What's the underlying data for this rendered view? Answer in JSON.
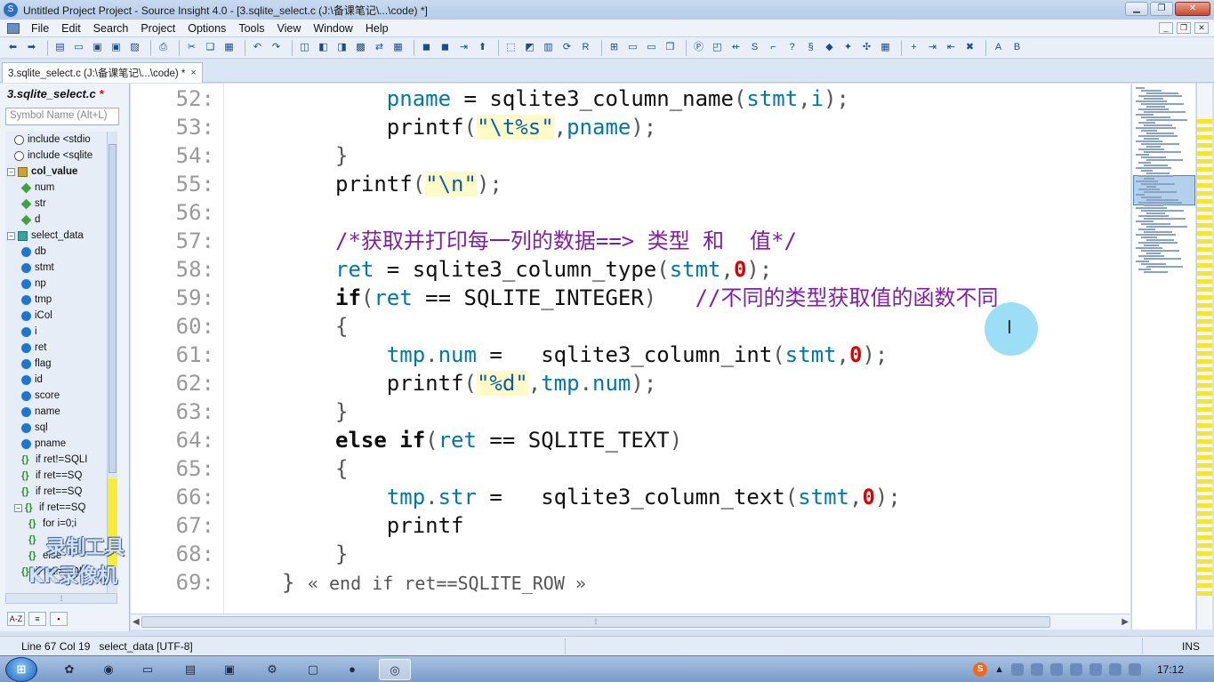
{
  "window": {
    "title": "Untitled Project Project - Source Insight 4.0 - [3.sqlite_select.c (J:\\备课笔记\\...\\code) *]"
  },
  "menu": [
    "File",
    "Edit",
    "Search",
    "Project",
    "Options",
    "Tools",
    "View",
    "Window",
    "Help"
  ],
  "tab": {
    "label": "3.sqlite_select.c (J:\\备课笔记\\...\\code) *",
    "close": "×"
  },
  "symbol_panel": {
    "title": "3.sqlite_select.c",
    "modified_mark": "*",
    "search_placeholder": "Symbol Name (Alt+L)",
    "items": [
      {
        "indent": 1,
        "icon": "hash",
        "label": "include <stdio",
        "twisty": ""
      },
      {
        "indent": 1,
        "icon": "hash",
        "label": "include <sqlite",
        "twisty": ""
      },
      {
        "indent": 0,
        "icon": "struct",
        "label": "col_value",
        "twisty": "−",
        "bold": true
      },
      {
        "indent": 2,
        "icon": "field",
        "label": "num",
        "twisty": ""
      },
      {
        "indent": 2,
        "icon": "field",
        "label": "str",
        "twisty": ""
      },
      {
        "indent": 2,
        "icon": "field",
        "label": "d",
        "twisty": ""
      },
      {
        "indent": 0,
        "icon": "func",
        "label": "select_data",
        "twisty": "−"
      },
      {
        "indent": 2,
        "icon": "var",
        "label": "db",
        "twisty": ""
      },
      {
        "indent": 2,
        "icon": "var",
        "label": "stmt",
        "twisty": ""
      },
      {
        "indent": 2,
        "icon": "var",
        "label": "np",
        "twisty": ""
      },
      {
        "indent": 2,
        "icon": "var",
        "label": "tmp",
        "twisty": ""
      },
      {
        "indent": 2,
        "icon": "var",
        "label": "iCol",
        "twisty": ""
      },
      {
        "indent": 2,
        "icon": "var",
        "label": "i",
        "twisty": ""
      },
      {
        "indent": 2,
        "icon": "var",
        "label": "ret",
        "twisty": ""
      },
      {
        "indent": 2,
        "icon": "var",
        "label": "flag",
        "twisty": ""
      },
      {
        "indent": 2,
        "icon": "var",
        "label": "id",
        "twisty": ""
      },
      {
        "indent": 2,
        "icon": "var",
        "label": "score",
        "twisty": ""
      },
      {
        "indent": 2,
        "icon": "var",
        "label": "name",
        "twisty": ""
      },
      {
        "indent": 2,
        "icon": "var",
        "label": "sql",
        "twisty": ""
      },
      {
        "indent": 2,
        "icon": "var",
        "label": "pname",
        "twisty": ""
      },
      {
        "indent": 2,
        "icon": "brace",
        "label": "if ret!=SQLI",
        "twisty": ""
      },
      {
        "indent": 2,
        "icon": "brace",
        "label": "if ret==SQ",
        "twisty": ""
      },
      {
        "indent": 2,
        "icon": "brace",
        "label": "if ret==SQ",
        "twisty": ""
      },
      {
        "indent": 1,
        "icon": "brace",
        "label": "if ret==SQ",
        "twisty": "−"
      },
      {
        "indent": 3,
        "icon": "brace",
        "label": "for i=0;i",
        "twisty": ""
      },
      {
        "indent": 3,
        "icon": "brace",
        "label": "",
        "twisty": ""
      },
      {
        "indent": 3,
        "icon": "brace",
        "label": "else",
        "twisty": ""
      },
      {
        "indent": 2,
        "icon": "brace",
        "label": "if ret!=SQL",
        "twisty": ""
      }
    ],
    "bottom_buttons": [
      "A-Z",
      "≡",
      "▪"
    ]
  },
  "editor": {
    "lines": [
      {
        "n": "52:",
        "tokens": [
          [
            "    pname ",
            "var"
          ],
          [
            "= ",
            "id"
          ],
          [
            "sqlite3_column_name",
            "id"
          ],
          [
            "(",
            "punc"
          ],
          [
            "stmt",
            "var"
          ],
          [
            ",",
            "punc"
          ],
          [
            "i",
            "var"
          ],
          [
            ");",
            "punc"
          ]
        ]
      },
      {
        "n": "53:",
        "tokens": [
          [
            "    printf",
            "id"
          ],
          [
            "(",
            "punc"
          ],
          [
            "\"\\t%s\"",
            "str"
          ],
          [
            ",",
            "punc"
          ],
          [
            "pname",
            "var"
          ],
          [
            ");",
            "punc"
          ]
        ]
      },
      {
        "n": "54:",
        "tokens": [
          [
            "}",
            "punc"
          ]
        ]
      },
      {
        "n": "55:",
        "tokens": [
          [
            "printf",
            "id"
          ],
          [
            "(",
            "punc"
          ],
          [
            "\"\\n\"",
            "str"
          ],
          [
            ");",
            "punc"
          ]
        ]
      },
      {
        "n": "56:",
        "tokens": []
      },
      {
        "n": "57:",
        "tokens": [
          [
            "/*获取并打印每一列的数据==> 类型 和  值*/",
            "cmt"
          ]
        ]
      },
      {
        "n": "58:",
        "tokens": [
          [
            "ret ",
            "var"
          ],
          [
            "= ",
            "id"
          ],
          [
            "sqlite3_column_type",
            "id"
          ],
          [
            "(",
            "punc"
          ],
          [
            "stmt",
            "var"
          ],
          [
            ",",
            "punc"
          ],
          [
            "0",
            "num"
          ],
          [
            ");",
            "punc"
          ]
        ]
      },
      {
        "n": "59:",
        "tokens": [
          [
            "if",
            "kw"
          ],
          [
            "(",
            "punc"
          ],
          [
            "ret ",
            "var"
          ],
          [
            "== SQLITE_INTEGER",
            "id"
          ],
          [
            ")   ",
            "punc"
          ],
          [
            "//不同的类型获取值的函数不同",
            "cmt"
          ]
        ]
      },
      {
        "n": "60:",
        "tokens": [
          [
            "{",
            "punc"
          ]
        ]
      },
      {
        "n": "61:",
        "tokens": [
          [
            "    tmp",
            "var"
          ],
          [
            ".",
            "punc"
          ],
          [
            "num ",
            "var"
          ],
          [
            "=   sqlite3_column_int",
            "id"
          ],
          [
            "(",
            "punc"
          ],
          [
            "stmt",
            "var"
          ],
          [
            ",",
            "punc"
          ],
          [
            "0",
            "num"
          ],
          [
            ");",
            "punc"
          ]
        ]
      },
      {
        "n": "62:",
        "tokens": [
          [
            "    printf",
            "id"
          ],
          [
            "(",
            "punc"
          ],
          [
            "\"%d\"",
            "str"
          ],
          [
            ",",
            "punc"
          ],
          [
            "tmp",
            "var"
          ],
          [
            ".",
            "punc"
          ],
          [
            "num",
            "var"
          ],
          [
            ");",
            "punc"
          ]
        ]
      },
      {
        "n": "63:",
        "tokens": [
          [
            "}",
            "punc"
          ]
        ]
      },
      {
        "n": "64:",
        "tokens": [
          [
            "else if",
            "kw"
          ],
          [
            "(",
            "punc"
          ],
          [
            "ret ",
            "var"
          ],
          [
            "== SQLITE_TEXT",
            "id"
          ],
          [
            ")",
            "punc"
          ]
        ]
      },
      {
        "n": "65:",
        "tokens": [
          [
            "{",
            "punc"
          ]
        ]
      },
      {
        "n": "66:",
        "tokens": [
          [
            "    tmp",
            "var"
          ],
          [
            ".",
            "punc"
          ],
          [
            "str ",
            "var"
          ],
          [
            "=   sqlite3_column_text",
            "id"
          ],
          [
            "(",
            "punc"
          ],
          [
            "stmt",
            "var"
          ],
          [
            ",",
            "punc"
          ],
          [
            "0",
            "num"
          ],
          [
            ");",
            "punc"
          ]
        ]
      },
      {
        "n": "67:",
        "tokens": [
          [
            "    printf",
            "id"
          ]
        ]
      },
      {
        "n": "68:",
        "tokens": [
          [
            "}",
            "punc"
          ]
        ]
      },
      {
        "n": "69:",
        "tokens": [
          [
            "} ",
            "punc"
          ],
          [
            "« end if ret==SQLITE_ROW »",
            "endcmt"
          ]
        ]
      }
    ]
  },
  "watermark": {
    "line1": "录制工具",
    "line2": "KK录像机"
  },
  "status": {
    "position": "Line 67  Col 19",
    "context": "select_data [UTF-8]",
    "mode": "INS"
  },
  "taskbar": {
    "clock": "17:12",
    "ime": "S"
  }
}
